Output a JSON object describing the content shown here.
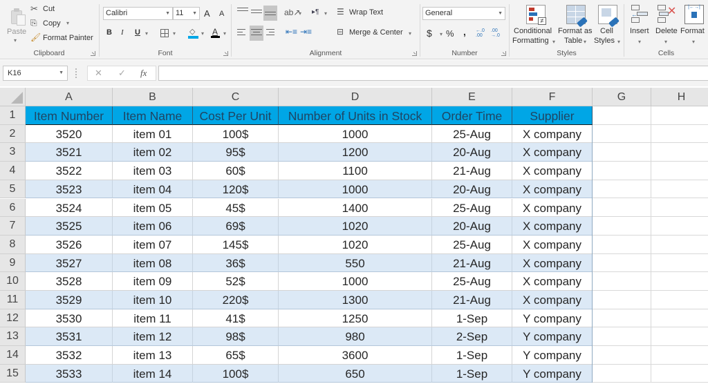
{
  "ribbon": {
    "clipboard": {
      "group_label": "Clipboard",
      "paste": "Paste",
      "cut": "Cut",
      "copy": "Copy",
      "format_painter": "Format Painter"
    },
    "font": {
      "group_label": "Font",
      "font_name": "Calibri",
      "font_size": "11",
      "grow": "A",
      "shrink": "A",
      "bold": "B",
      "italic": "I",
      "underline": "U",
      "fill_color": "#00a6e6",
      "font_color": "#000000"
    },
    "alignment": {
      "group_label": "Alignment",
      "wrap_text": "Wrap Text",
      "merge_center": "Merge & Center"
    },
    "number": {
      "group_label": "Number",
      "format": "General",
      "currency": "$",
      "percent": "%",
      "comma": ",",
      "inc_decimal": "←.0 .00",
      "dec_decimal": ".00 →.0"
    },
    "styles": {
      "group_label": "Styles",
      "conditional_formatting": [
        "Conditional",
        "Formatting"
      ],
      "format_as_table": [
        "Format as",
        "Table"
      ],
      "cell_styles": [
        "Cell",
        "Styles"
      ]
    },
    "cells": {
      "group_label": "Cells",
      "insert": "Insert",
      "delete": "Delete",
      "format": "Format"
    }
  },
  "formula_bar": {
    "name_box": "K16",
    "cancel_icon": "✕",
    "enter_icon": "✓",
    "fx_label": "fx",
    "formula": ""
  },
  "sheet": {
    "columns": [
      "A",
      "B",
      "C",
      "D",
      "E",
      "F",
      "G",
      "H"
    ],
    "row_numbers": [
      "1",
      "2",
      "3",
      "4",
      "5",
      "6",
      "7",
      "8",
      "9",
      "10",
      "11",
      "12",
      "13",
      "14",
      "15"
    ],
    "header_fill": "#00a6e6",
    "band_fill": "#dce9f6",
    "headers": [
      "Item Number",
      "Item Name",
      "Cost Per Unit",
      "Number of Units in Stock",
      "Order Time",
      "Supplier"
    ],
    "rows": [
      [
        "3520",
        "item 01",
        "100$",
        "1000",
        "25-Aug",
        "X company"
      ],
      [
        "3521",
        "item 02",
        "95$",
        "1200",
        "20-Aug",
        "X company"
      ],
      [
        "3522",
        "item 03",
        "60$",
        "1100",
        "21-Aug",
        "X company"
      ],
      [
        "3523",
        "item 04",
        "120$",
        "1000",
        "20-Aug",
        "X company"
      ],
      [
        "3524",
        "item 05",
        "45$",
        "1400",
        "25-Aug",
        "X company"
      ],
      [
        "3525",
        "item 06",
        "69$",
        "1020",
        "20-Aug",
        "X company"
      ],
      [
        "3526",
        "item 07",
        "145$",
        "1020",
        "25-Aug",
        "X company"
      ],
      [
        "3527",
        "item 08",
        "36$",
        "550",
        "21-Aug",
        "X company"
      ],
      [
        "3528",
        "item 09",
        "52$",
        "1000",
        "25-Aug",
        "X company"
      ],
      [
        "3529",
        "item 10",
        "220$",
        "1300",
        "21-Aug",
        "X company"
      ],
      [
        "3530",
        "item 11",
        "41$",
        "1250",
        "1-Sep",
        "Y company"
      ],
      [
        "3531",
        "item 12",
        "98$",
        "980",
        "2-Sep",
        "Y company"
      ],
      [
        "3532",
        "item 13",
        "65$",
        "3600",
        "1-Sep",
        "Y company"
      ],
      [
        "3533",
        "item 14",
        "100$",
        "650",
        "1-Sep",
        "Y company"
      ]
    ]
  }
}
